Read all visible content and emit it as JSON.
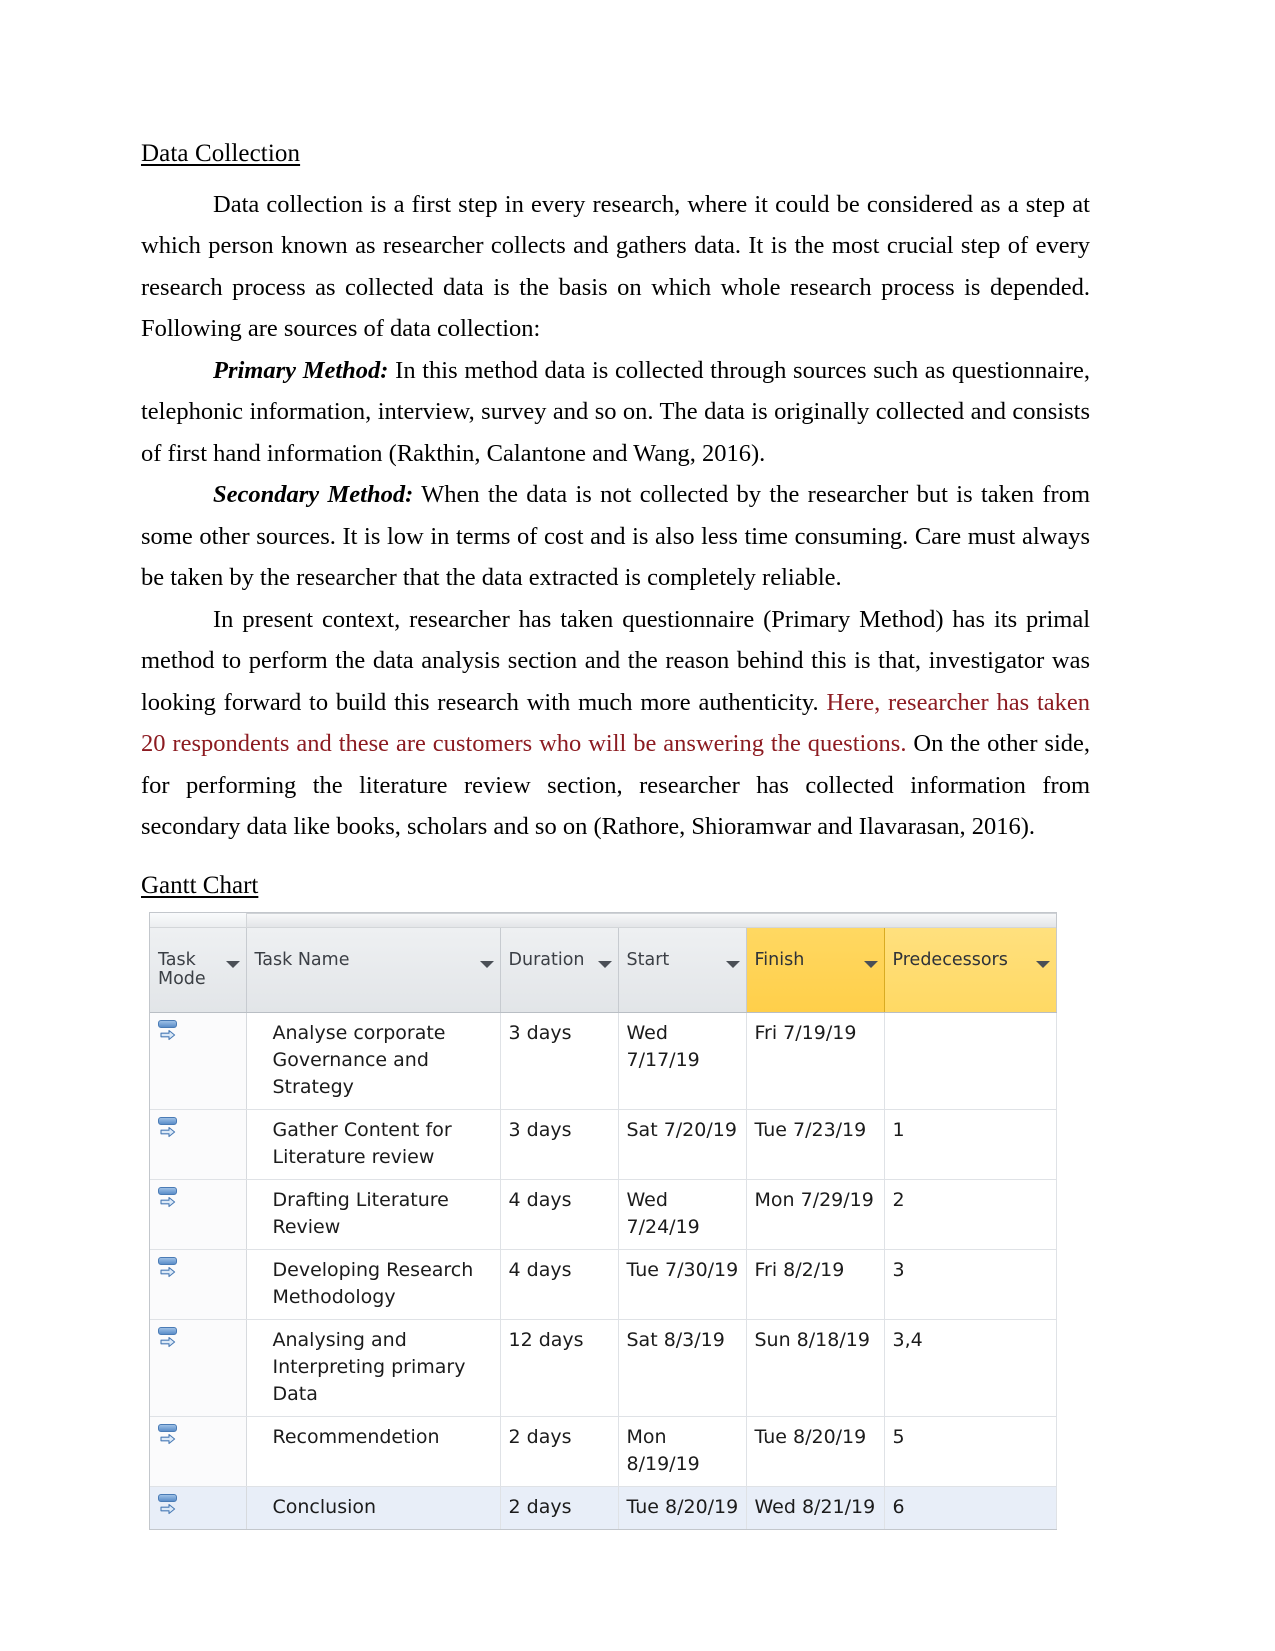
{
  "document": {
    "heading": "Data Collection",
    "paragraphs": [
      {
        "id": "p1",
        "indent": true,
        "runs": [
          {
            "text": "Data collection is a first step in every research, where it could be considered as a step at which person known as researcher collects and gathers data. It is the most crucial step of every research process as collected data is the basis on which whole research process is depended. Following are sources of data collection:",
            "style": "normal"
          }
        ]
      },
      {
        "id": "p2",
        "indent": true,
        "runs": [
          {
            "text": "Primary Method:",
            "style": "bold-italic"
          },
          {
            "text": " In this method data is collected through sources such as questionnaire, telephonic information, interview, survey and so on. The data is originally collected and consists of first hand information (Rakthin, Calantone and Wang,  2016).",
            "style": "normal"
          }
        ]
      },
      {
        "id": "p3",
        "indent": true,
        "runs": [
          {
            "text": "Secondary Method:",
            "style": "bold-italic"
          },
          {
            "text": " When the data is not collected by the researcher but is taken from some other sources. It is low in terms of cost and is also less time consuming. Care must always be taken by the researcher that the data extracted is completely reliable.",
            "style": "normal"
          }
        ]
      },
      {
        "id": "p4",
        "indent": true,
        "runs": [
          {
            "text": "In present context, researcher has taken questionnaire (Primary Method) has its primal method to perform the data analysis section and the reason behind this is that, investigator was looking forward to build this research with much more authenticity. ",
            "style": "normal"
          },
          {
            "text": "Here, researcher has taken 20 respondents and these are customers who will be answering the questions.",
            "style": "red"
          },
          {
            "text": " On the other side, for performing the literature review section, researcher has collected information from secondary data like books, scholars and so on (Rathore, Shioramwar and Ilavarasan, 2016).",
            "style": "normal"
          }
        ]
      }
    ],
    "gantt_heading": "Gantt Chart"
  },
  "colors": {
    "red_text": "#8c1b21",
    "finish_header_bg": "#ffd14a",
    "predecessors_header_bg": "#ffdb66",
    "selected_row_bg": "#e8eef8",
    "task_mode_icon": "#5b8ec9"
  },
  "gantt_table": {
    "columns": [
      {
        "key": "mode",
        "label": "Task\nMode",
        "has_filter": true,
        "highlight": "none"
      },
      {
        "key": "name",
        "label": "Task Name",
        "has_filter": true,
        "highlight": "none"
      },
      {
        "key": "dur",
        "label": "Duration",
        "has_filter": true,
        "highlight": "none"
      },
      {
        "key": "start",
        "label": "Start",
        "has_filter": true,
        "highlight": "none"
      },
      {
        "key": "fin",
        "label": "Finish",
        "has_filter": true,
        "highlight": "finish"
      },
      {
        "key": "pred",
        "label": "Predecessors",
        "has_filter": true,
        "highlight": "predecessors"
      }
    ],
    "rows": [
      {
        "mode_icon": "auto-scheduled-icon",
        "name": "Analyse corporate Governance and Strategy",
        "duration": "3 days",
        "start": "Wed 7/17/19",
        "finish": "Fri 7/19/19",
        "predecessors": "",
        "selected": false
      },
      {
        "mode_icon": "auto-scheduled-icon",
        "name": "Gather Content for Literature review",
        "duration": "3 days",
        "start": "Sat 7/20/19",
        "finish": "Tue 7/23/19",
        "predecessors": "1",
        "selected": false
      },
      {
        "mode_icon": "auto-scheduled-icon",
        "name": "Drafting Literature Review",
        "duration": "4 days",
        "start": "Wed 7/24/19",
        "finish": "Mon 7/29/19",
        "predecessors": "2",
        "selected": false
      },
      {
        "mode_icon": "auto-scheduled-icon",
        "name": "Developing Research Methodology",
        "duration": "4 days",
        "start": "Tue 7/30/19",
        "finish": "Fri 8/2/19",
        "predecessors": "3",
        "selected": false
      },
      {
        "mode_icon": "auto-scheduled-icon",
        "name": "Analysing and Interpreting primary Data",
        "duration": "12 days",
        "start": "Sat 8/3/19",
        "finish": "Sun 8/18/19",
        "predecessors": "3,4",
        "selected": false
      },
      {
        "mode_icon": "auto-scheduled-icon",
        "name": "Recommendetion",
        "duration": "2 days",
        "start": "Mon 8/19/19",
        "finish": "Tue 8/20/19",
        "predecessors": "5",
        "selected": false
      },
      {
        "mode_icon": "auto-scheduled-icon",
        "name": "Conclusion",
        "duration": "2 days",
        "start": "Tue 8/20/19",
        "finish": "Wed 8/21/19",
        "predecessors": "6",
        "selected": true
      }
    ]
  }
}
